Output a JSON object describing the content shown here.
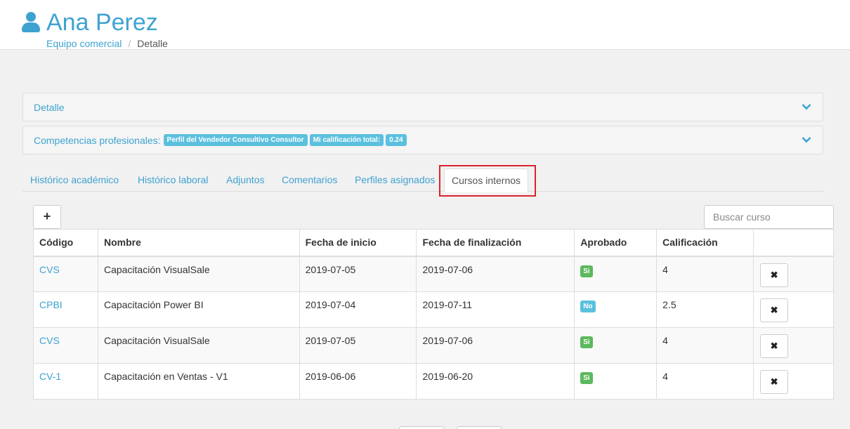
{
  "header": {
    "title": "Ana Perez",
    "breadcrumb": {
      "link": "Equipo comercial",
      "separator": "/",
      "current": "Detalle"
    }
  },
  "panels": {
    "detail": {
      "title": "Detalle"
    },
    "competencias": {
      "title": "Competencias profesionales:",
      "badges": [
        "Perfil del Vendedor Consultivo Consultor",
        "Mi calificación total:",
        "0.24"
      ]
    }
  },
  "tabs": [
    {
      "label": "Histórico académico"
    },
    {
      "label": "Histórico laboral"
    },
    {
      "label": "Adjuntos"
    },
    {
      "label": "Comentarios"
    },
    {
      "label": "Perfiles asignados"
    },
    {
      "label": "Cursos internos",
      "active": true
    }
  ],
  "toolbar": {
    "add_label": "+",
    "search_placeholder": "Buscar curso"
  },
  "table": {
    "headers": [
      "Código",
      "Nombre",
      "Fecha de inicio",
      "Fecha de finalización",
      "Aprobado",
      "Calificación",
      ""
    ],
    "rows": [
      {
        "code": "CVS",
        "name": "Capacitación VisualSale",
        "start": "2019-07-05",
        "end": "2019-07-06",
        "approved": "Si",
        "grade": "4",
        "delete": "✖"
      },
      {
        "code": "CPBI",
        "name": "Capacitación Power BI",
        "start": "2019-07-04",
        "end": "2019-07-11",
        "approved": "No",
        "grade": "2.5",
        "delete": "✖"
      },
      {
        "code": "CVS",
        "name": "Capacitación VisualSale",
        "start": "2019-07-05",
        "end": "2019-07-06",
        "approved": "Si",
        "grade": "4",
        "delete": "✖"
      },
      {
        "code": "CV-1",
        "name": "Capacitación en Ventas - V1",
        "start": "2019-06-06",
        "end": "2019-06-20",
        "approved": "Si",
        "grade": "4",
        "delete": "✖"
      }
    ]
  },
  "colors": {
    "accent": "#3ea2d1",
    "success": "#5cb85c",
    "info": "#5bc0de",
    "highlight": "#d9232d"
  }
}
